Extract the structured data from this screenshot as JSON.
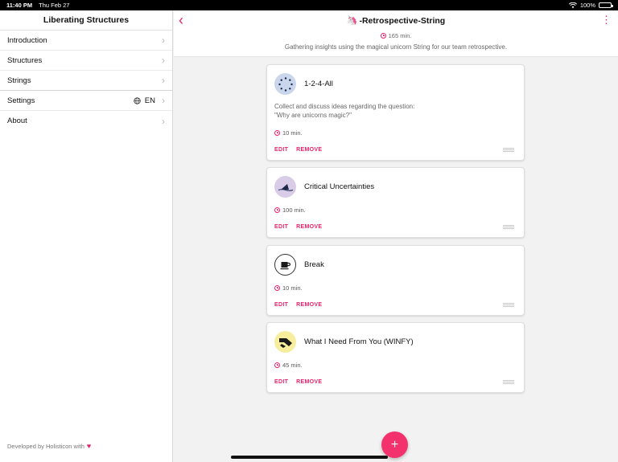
{
  "status": {
    "time": "11:40 PM",
    "date": "Thu Feb 27",
    "battery": "100%",
    "battery_level": 1.0
  },
  "sidebar": {
    "title": "Liberating Structures",
    "items": [
      {
        "label": "Introduction"
      },
      {
        "label": "Structures"
      },
      {
        "label": "Strings"
      },
      {
        "label": "Settings",
        "value": "EN"
      },
      {
        "label": "About"
      }
    ],
    "footer": "Developed by Holisticon with"
  },
  "header": {
    "title": "-Retrospective-String",
    "duration": "165 min.",
    "subtitle": "Gathering insights using the magical unicorn String for our team retrospective."
  },
  "cards": [
    {
      "name": "1-2-4-All",
      "description_lines": [
        "Collect and discuss ideas regarding the question:",
        "\"Why are unicorns magic?\""
      ],
      "duration": "10 min.",
      "icon": "circle-dots-icon",
      "color": "#c9d6ec"
    },
    {
      "name": "Critical Uncertainties",
      "duration": "100 min.",
      "icon": "shark-fin-icon",
      "color": "#d8cce8"
    },
    {
      "name": "Break",
      "duration": "10 min.",
      "icon": "coffee-cup-icon",
      "color": "#ffffff"
    },
    {
      "name": "What I Need From You (WINFY)",
      "duration": "45 min.",
      "icon": "hands-icon",
      "color": "#f6ee9c"
    }
  ],
  "actions": {
    "edit": "EDIT",
    "remove": "REMOVE"
  },
  "fab_label": "+",
  "accent": "#e8206a"
}
